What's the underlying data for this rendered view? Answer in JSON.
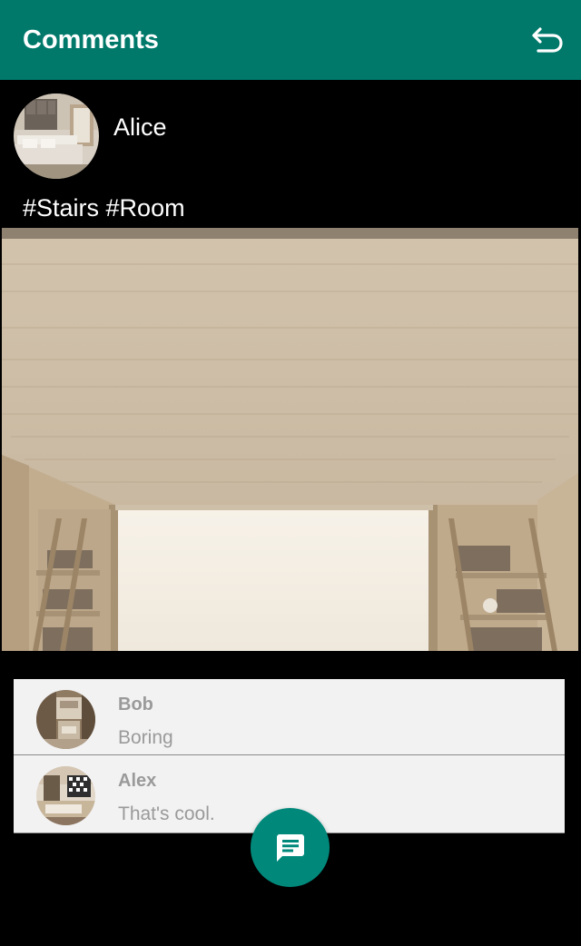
{
  "toolbar": {
    "title": "Comments",
    "back_icon": "undo-arrow-icon",
    "color": "#00796b"
  },
  "post": {
    "author": "Alice",
    "tags": "#Stairs #Room",
    "image": "room-interior-photo"
  },
  "comments": [
    {
      "author": "Bob",
      "text": "Boring",
      "avatar": "kitchen-photo"
    },
    {
      "author": "Alex",
      "text": "That's cool.",
      "avatar": "living-room-photo"
    }
  ],
  "fab": {
    "icon": "chat-message-icon",
    "color": "#00897b"
  }
}
